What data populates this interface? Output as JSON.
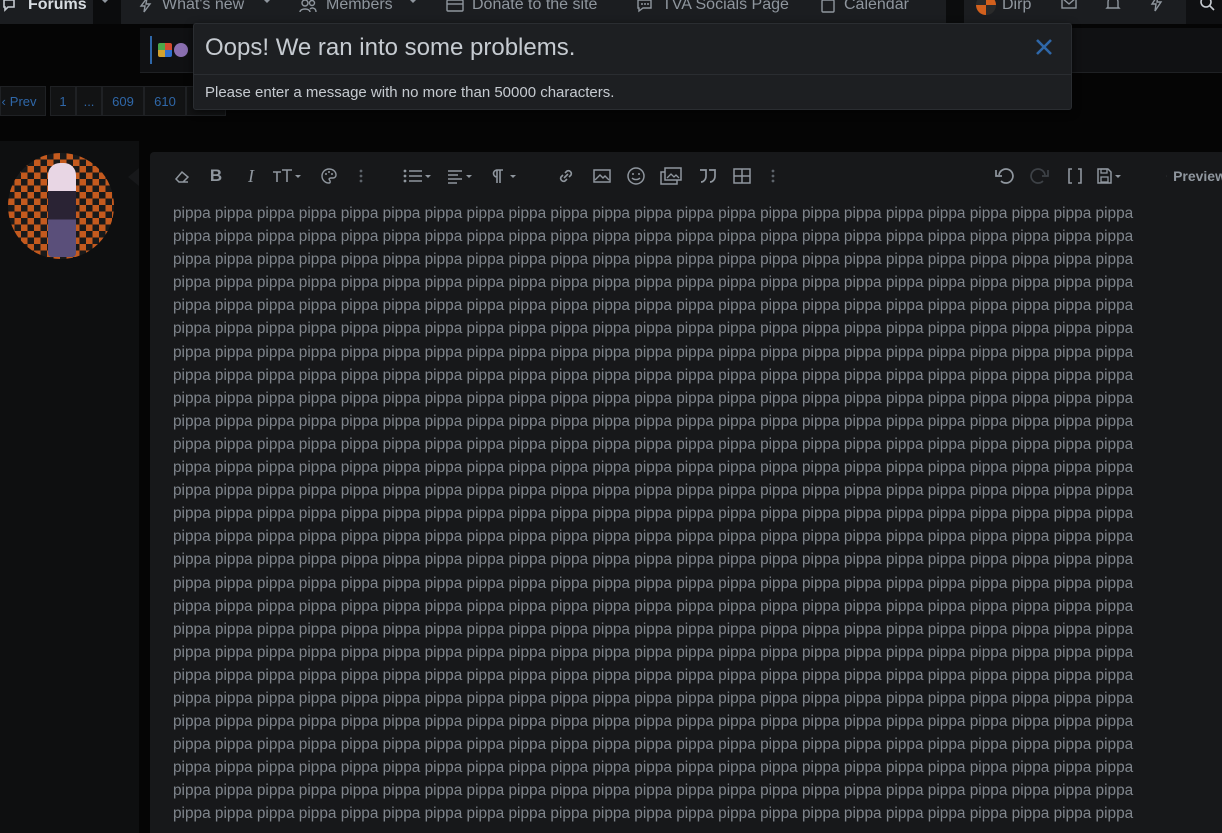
{
  "nav": {
    "forums": "Forums",
    "whats_new": "What's new",
    "members": "Members",
    "donate": "Donate to the site",
    "socials": "TVA Socials Page",
    "calendar": "Calendar",
    "username": "Dirp"
  },
  "pagination": {
    "prev": "Prev",
    "pages": [
      "1",
      "...",
      "609",
      "610"
    ]
  },
  "editor": {
    "toolbar": [
      "eraser-icon",
      "bold-icon",
      "italic-icon",
      "font-size-icon",
      "paint-palette-icon",
      "more-vertical-icon",
      "list-icon",
      "align-icon",
      "paragraph-icon",
      "link-icon",
      "image-icon",
      "smiley-icon",
      "media-icon",
      "quote-icon",
      "table-icon",
      "more-vertical-icon",
      "undo-icon",
      "redo-icon",
      "toggle-bbcode-icon",
      "drafts-icon",
      "preview-icon"
    ],
    "preview_label": "Preview",
    "content_word": "pippa",
    "words_per_line": 23,
    "lines": 27
  },
  "error": {
    "title": "Oops! We ran into some problems.",
    "message": "Please enter a message with no more than 50000 characters."
  },
  "colors": {
    "accent": "#2f67a8",
    "background": "#050505",
    "editor_bg": "#17181a",
    "text": "#7f858c"
  }
}
